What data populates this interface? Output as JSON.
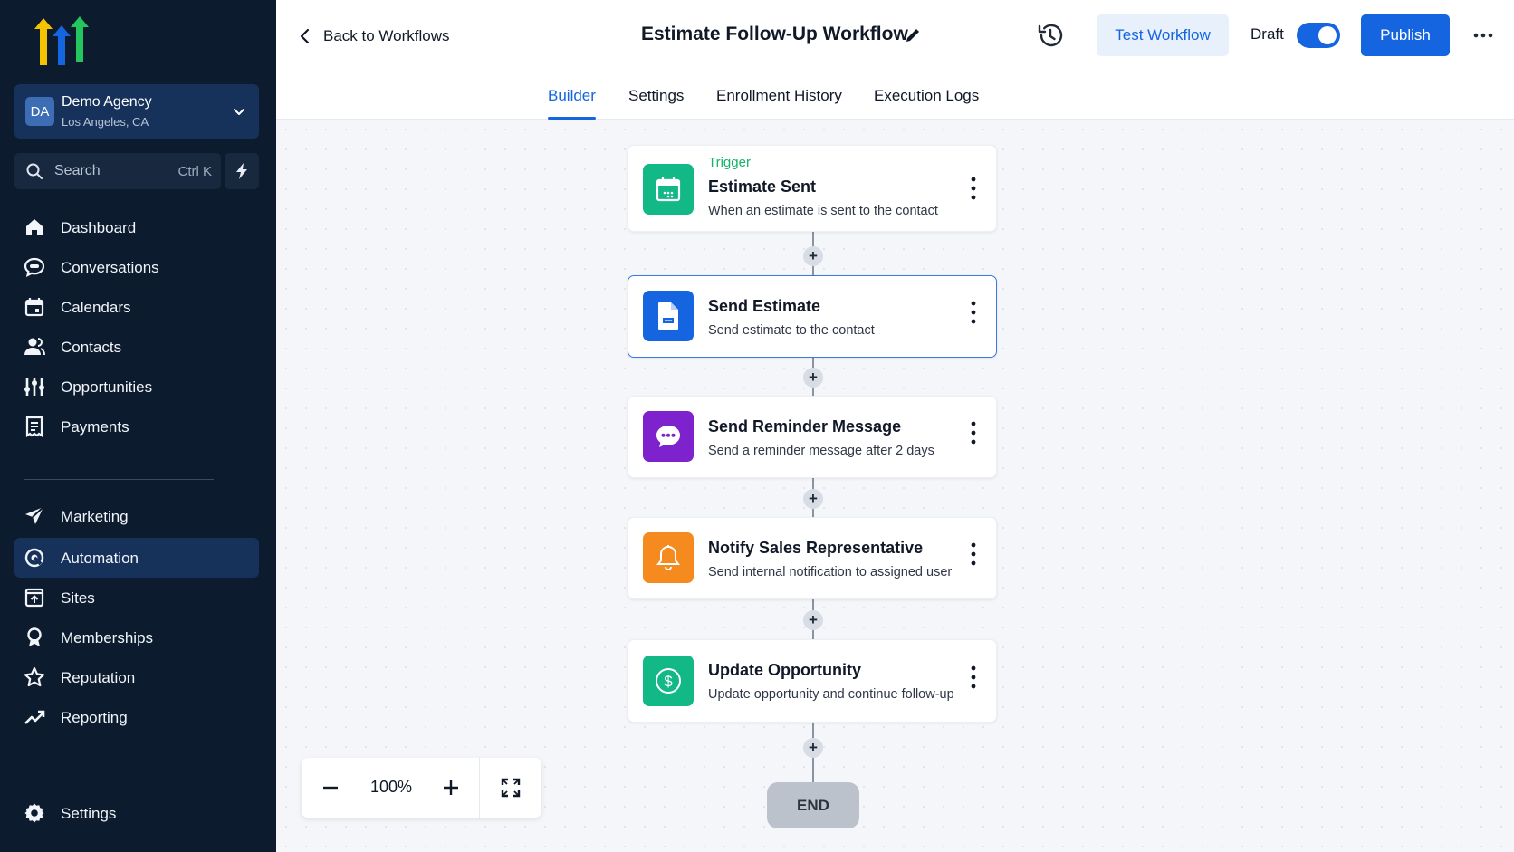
{
  "app": {
    "logo_colors": [
      "#f5c400",
      "#1565e0",
      "#22c55e"
    ]
  },
  "agency": {
    "initials": "DA",
    "name": "Demo Agency",
    "location": "Los Angeles, CA"
  },
  "search": {
    "placeholder": "Search",
    "shortcut": "Ctrl K"
  },
  "sidebar": {
    "items": [
      {
        "label": "Dashboard",
        "icon": "home-icon"
      },
      {
        "label": "Conversations",
        "icon": "chat-icon"
      },
      {
        "label": "Calendars",
        "icon": "calendar-icon"
      },
      {
        "label": "Contacts",
        "icon": "contacts-icon"
      },
      {
        "label": "Opportunities",
        "icon": "opportunities-icon"
      },
      {
        "label": "Payments",
        "icon": "payments-icon"
      }
    ],
    "items2": [
      {
        "label": "Marketing",
        "icon": "send-icon"
      },
      {
        "label": "Automation",
        "icon": "automation-icon",
        "active": true
      },
      {
        "label": "Sites",
        "icon": "sites-icon"
      },
      {
        "label": "Memberships",
        "icon": "badge-icon"
      },
      {
        "label": "Reputation",
        "icon": "star-icon"
      },
      {
        "label": "Reporting",
        "icon": "trend-icon"
      }
    ],
    "settings_label": "Settings"
  },
  "header": {
    "back_label": "Back to Workflows",
    "title": "Estimate Follow-Up Workflow",
    "test_label": "Test Workflow",
    "draft_label": "Draft",
    "draft_toggle_on": true,
    "publish_label": "Publish"
  },
  "tabs": [
    {
      "label": "Builder",
      "active": true
    },
    {
      "label": "Settings"
    },
    {
      "label": "Enrollment History"
    },
    {
      "label": "Execution Logs"
    }
  ],
  "workflow": {
    "trigger_kind": "Trigger",
    "steps": [
      {
        "title": "Estimate Sent",
        "desc": "When an estimate is sent to the contact",
        "icon": "calendar-icon",
        "color": "#12b886"
      },
      {
        "title": "Send Estimate",
        "desc": "Send estimate to the contact",
        "icon": "document-icon",
        "color": "#1565e0"
      },
      {
        "title": "Send Reminder Message",
        "desc": "Send a reminder message after 2 days",
        "icon": "message-icon",
        "color": "#7e22ce"
      },
      {
        "title": "Notify Sales Representative",
        "desc": "Send internal notification to assigned user",
        "icon": "bell-icon",
        "color": "#f58a1f"
      },
      {
        "title": "Update Opportunity",
        "desc": "Update opportunity and continue follow-up",
        "icon": "dollar-icon",
        "color": "#12b886"
      }
    ],
    "end_label": "END"
  },
  "zoom": {
    "value": "100%"
  }
}
